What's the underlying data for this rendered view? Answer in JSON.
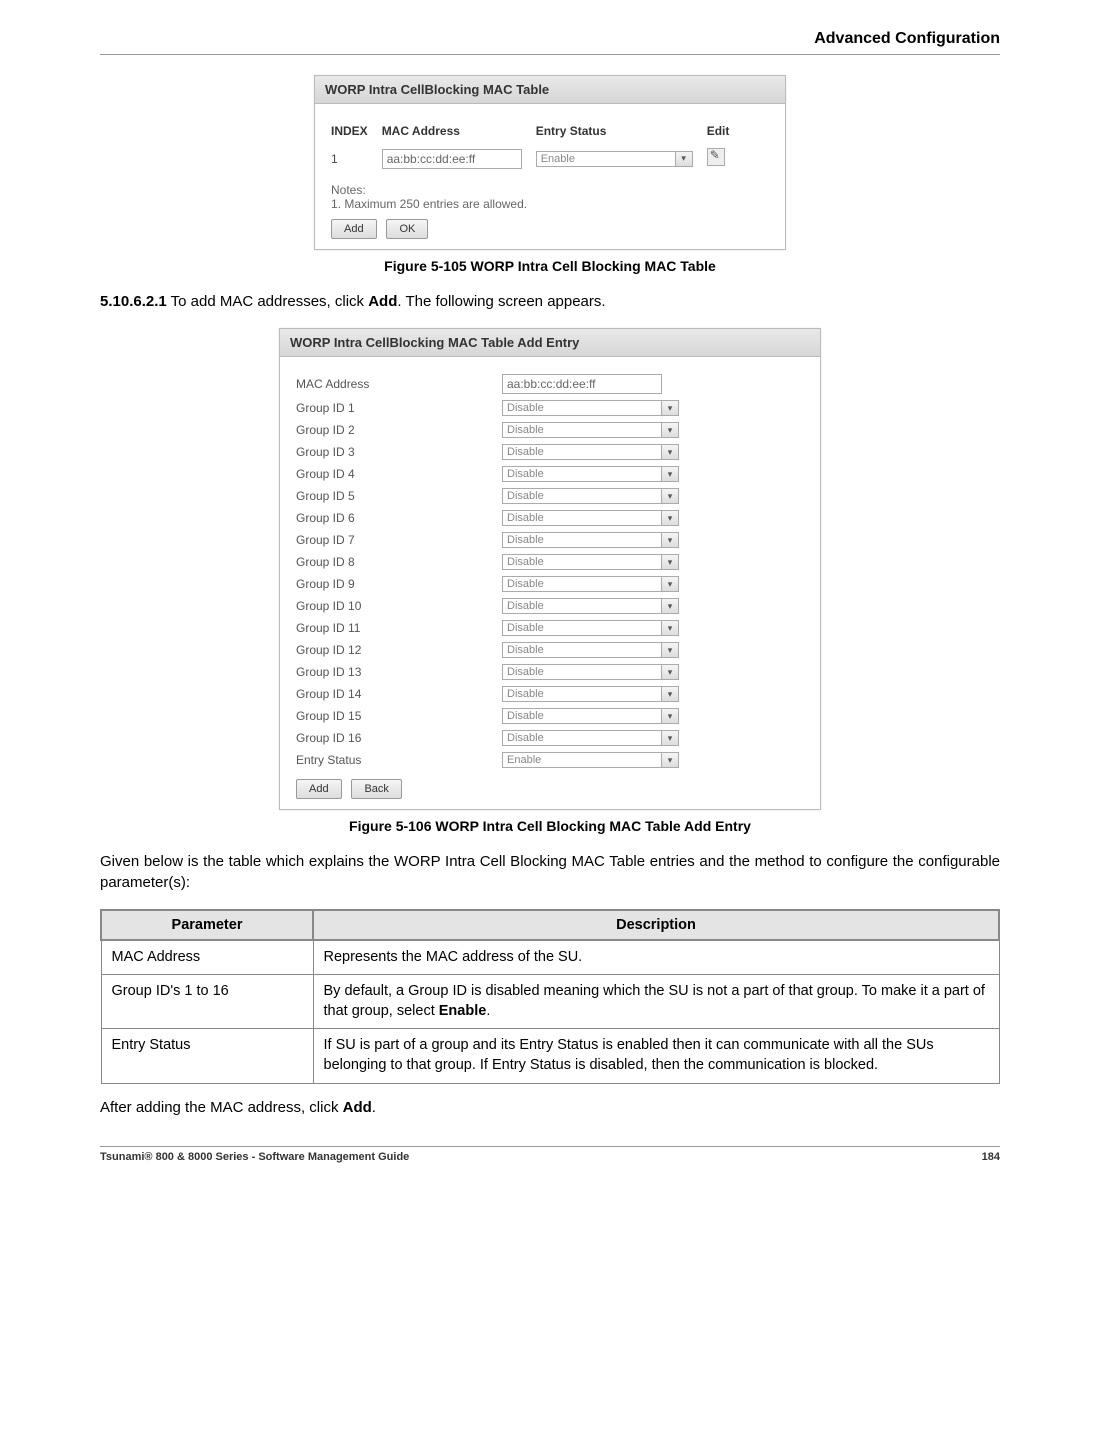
{
  "header": {
    "title": "Advanced Configuration"
  },
  "panel1": {
    "title": "WORP Intra CellBlocking MAC Table",
    "cols": {
      "index": "INDEX",
      "mac": "MAC Address",
      "status": "Entry Status",
      "edit": "Edit"
    },
    "row": {
      "index": "1",
      "mac": "aa:bb:cc:dd:ee:ff",
      "status": "Enable"
    },
    "notes_label": "Notes:",
    "notes_line": "1. Maximum 250 entries are allowed.",
    "btn_add": "Add",
    "btn_ok": "OK"
  },
  "fig1_caption": "Figure 5-105 WORP Intra Cell Blocking MAC Table",
  "para1": {
    "num": "5.10.6.2.1",
    "pre": " To add MAC addresses, click ",
    "bold": "Add",
    "post": ". The following screen appears."
  },
  "panel2": {
    "title": "WORP Intra CellBlocking MAC Table Add Entry",
    "rows": [
      {
        "label": "MAC Address",
        "type": "text",
        "value": "aa:bb:cc:dd:ee:ff"
      },
      {
        "label": "Group ID 1",
        "type": "select",
        "value": "Disable"
      },
      {
        "label": "Group ID 2",
        "type": "select",
        "value": "Disable"
      },
      {
        "label": "Group ID 3",
        "type": "select",
        "value": "Disable"
      },
      {
        "label": "Group ID 4",
        "type": "select",
        "value": "Disable"
      },
      {
        "label": "Group ID 5",
        "type": "select",
        "value": "Disable"
      },
      {
        "label": "Group ID 6",
        "type": "select",
        "value": "Disable"
      },
      {
        "label": "Group ID 7",
        "type": "select",
        "value": "Disable"
      },
      {
        "label": "Group ID 8",
        "type": "select",
        "value": "Disable"
      },
      {
        "label": "Group ID 9",
        "type": "select",
        "value": "Disable"
      },
      {
        "label": "Group ID 10",
        "type": "select",
        "value": "Disable"
      },
      {
        "label": "Group ID 11",
        "type": "select",
        "value": "Disable"
      },
      {
        "label": "Group ID 12",
        "type": "select",
        "value": "Disable"
      },
      {
        "label": "Group ID 13",
        "type": "select",
        "value": "Disable"
      },
      {
        "label": "Group ID 14",
        "type": "select",
        "value": "Disable"
      },
      {
        "label": "Group ID 15",
        "type": "select",
        "value": "Disable"
      },
      {
        "label": "Group ID 16",
        "type": "select",
        "value": "Disable"
      },
      {
        "label": "Entry Status",
        "type": "select",
        "value": "Enable"
      }
    ],
    "btn_add": "Add",
    "btn_back": "Back"
  },
  "fig2_caption": "Figure 5-106 WORP Intra Cell Blocking MAC Table Add Entry",
  "para2": "Given below is the table which explains the WORP Intra Cell Blocking MAC Table entries and the method to configure the configurable parameter(s):",
  "param_table": {
    "head": {
      "param": "Parameter",
      "desc": "Description"
    },
    "rows": [
      {
        "param": "MAC Address",
        "desc_pre": "Represents the MAC address of the SU.",
        "desc_bold": "",
        "desc_post": ""
      },
      {
        "param": "Group ID's 1 to 16",
        "desc_pre": "By default, a Group ID is disabled meaning which the SU is not a part of that group. To make it a part of that group, select ",
        "desc_bold": "Enable",
        "desc_post": "."
      },
      {
        "param": "Entry Status",
        "desc_pre": "If SU is part of a group and its Entry Status is enabled then it can communicate with all the SUs belonging to that group. If Entry Status is disabled, then the communication is blocked.",
        "desc_bold": "",
        "desc_post": ""
      }
    ]
  },
  "para3": {
    "pre": "After adding the MAC address, click ",
    "bold": "Add",
    "post": "."
  },
  "footer": {
    "left": "Tsunami® 800 & 8000 Series - Software Management Guide",
    "right": "184"
  }
}
